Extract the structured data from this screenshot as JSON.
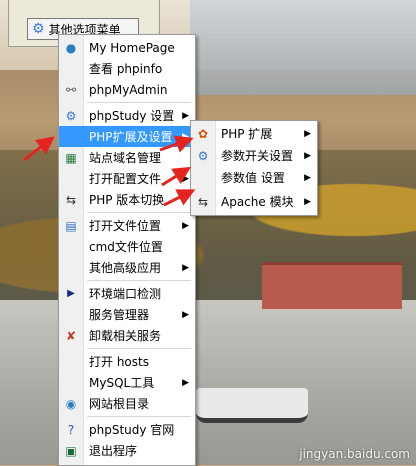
{
  "dialog": {
    "button_label": "其他选项菜单"
  },
  "main_menu": {
    "items": [
      {
        "label": "My HomePage",
        "icon": "globe-icon"
      },
      {
        "label": "查看 phpinfo",
        "icon": ""
      },
      {
        "label": "phpMyAdmin",
        "icon": "database-icon"
      },
      {
        "label": "phpStudy 设置",
        "icon": "gear-icon",
        "has_submenu": true
      },
      {
        "label": "PHP扩展及设置",
        "icon": "",
        "has_submenu": true,
        "highlighted": true
      },
      {
        "label": "站点域名管理",
        "icon": "sites-icon"
      },
      {
        "label": "打开配置文件",
        "icon": "",
        "has_submenu": true
      },
      {
        "label": "PHP 版本切换",
        "icon": "switch-icon"
      },
      {
        "label": "打开文件位置",
        "icon": "folder-icon",
        "has_submenu": true
      },
      {
        "label": "cmd文件位置",
        "icon": ""
      },
      {
        "label": "其他高级应用",
        "icon": "",
        "has_submenu": true
      },
      {
        "label": "环境端口检测",
        "icon": "triangle-icon"
      },
      {
        "label": "服务管理器",
        "icon": "",
        "has_submenu": true
      },
      {
        "label": "卸载相关服务",
        "icon": "uninstall-icon"
      },
      {
        "label": "打开 hosts",
        "icon": ""
      },
      {
        "label": "MySQL工具",
        "icon": "",
        "has_submenu": true
      },
      {
        "label": "网站根目录",
        "icon": "globe2-icon"
      },
      {
        "label": "phpStudy 官网",
        "icon": "help-icon"
      },
      {
        "label": "退出程序",
        "icon": "exit-icon"
      }
    ]
  },
  "sub_menu": {
    "items": [
      {
        "label": "PHP 扩展",
        "icon": "php-ext-icon",
        "has_submenu": true
      },
      {
        "label": "参数开关设置",
        "icon": "gear-icon",
        "has_submenu": true
      },
      {
        "label": "参数值 设置",
        "icon": "",
        "has_submenu": true
      },
      {
        "label": "Apache 模块",
        "icon": "switch-icon",
        "has_submenu": true
      }
    ]
  },
  "watermark": "jingyan.baidu.com"
}
